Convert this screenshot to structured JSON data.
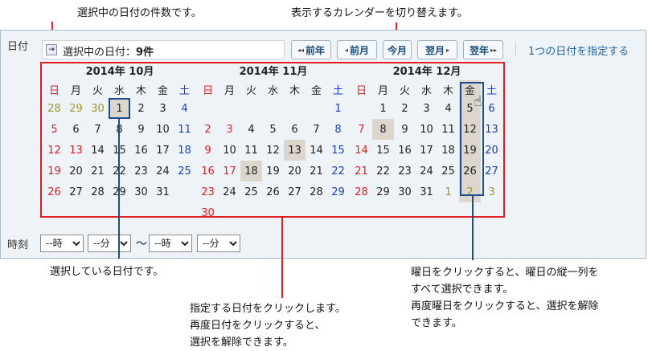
{
  "annotations": {
    "top_left": "選択中の日付の件数です。",
    "top_right": "表示するカレンダーを切り替えます。",
    "bottom_left": "選択している日付です。",
    "bottom_mid": [
      "指定する日付をクリックします。",
      "再度日付をクリックすると、",
      "選択を解除できます。"
    ],
    "bottom_right": [
      "曜日をクリックすると、曜日の縦一列を",
      "すべて選択できます。",
      "再度曜日をクリックすると、選択を解除",
      "できます。"
    ]
  },
  "form": {
    "date_label": "日付",
    "time_label": "時刻",
    "selected_count_label": "選択中の日付：",
    "selected_count_value": "9件",
    "specify_single_link": "1つの日付を指定する"
  },
  "nav": {
    "prev_year": "前年",
    "prev_month": "前月",
    "today": "今月",
    "next_month": "翌月",
    "next_year": "翌年"
  },
  "weekdays": [
    "日",
    "月",
    "火",
    "水",
    "木",
    "金",
    "土"
  ],
  "calendars": [
    {
      "title": "2014年 10月",
      "weeks": [
        [
          "28",
          "29",
          "30",
          "1",
          "2",
          "3",
          "4"
        ],
        [
          "5",
          "6",
          "7",
          "8",
          "9",
          "10",
          "11"
        ],
        [
          "12",
          "13",
          "14",
          "15",
          "16",
          "17",
          "18"
        ],
        [
          "19",
          "20",
          "21",
          "22",
          "23",
          "24",
          "25"
        ],
        [
          "26",
          "27",
          "28",
          "29",
          "30",
          "31",
          ""
        ]
      ]
    },
    {
      "title": "2014年 11月",
      "weeks": [
        [
          "",
          "",
          "",
          "",
          "",
          "",
          "1"
        ],
        [
          "2",
          "3",
          "4",
          "5",
          "6",
          "7",
          "8"
        ],
        [
          "9",
          "10",
          "11",
          "12",
          "13",
          "14",
          "15"
        ],
        [
          "16",
          "17",
          "18",
          "19",
          "20",
          "21",
          "22"
        ],
        [
          "23",
          "24",
          "25",
          "26",
          "27",
          "28",
          "29"
        ],
        [
          "30",
          "",
          "",
          "",
          "",
          "",
          ""
        ]
      ]
    },
    {
      "title": "2014年 12月",
      "weeks": [
        [
          "",
          "1",
          "2",
          "3",
          "4",
          "5",
          "6"
        ],
        [
          "7",
          "8",
          "9",
          "10",
          "11",
          "12",
          "13"
        ],
        [
          "14",
          "15",
          "16",
          "17",
          "18",
          "19",
          "20"
        ],
        [
          "21",
          "22",
          "23",
          "24",
          "25",
          "26",
          "27"
        ],
        [
          "28",
          "29",
          "30",
          "31",
          "1",
          "2",
          "3"
        ]
      ]
    }
  ],
  "time": {
    "start_hour": "--時",
    "start_min": "--分",
    "tilde": "〜",
    "end_hour": "--時",
    "end_min": "--分"
  }
}
